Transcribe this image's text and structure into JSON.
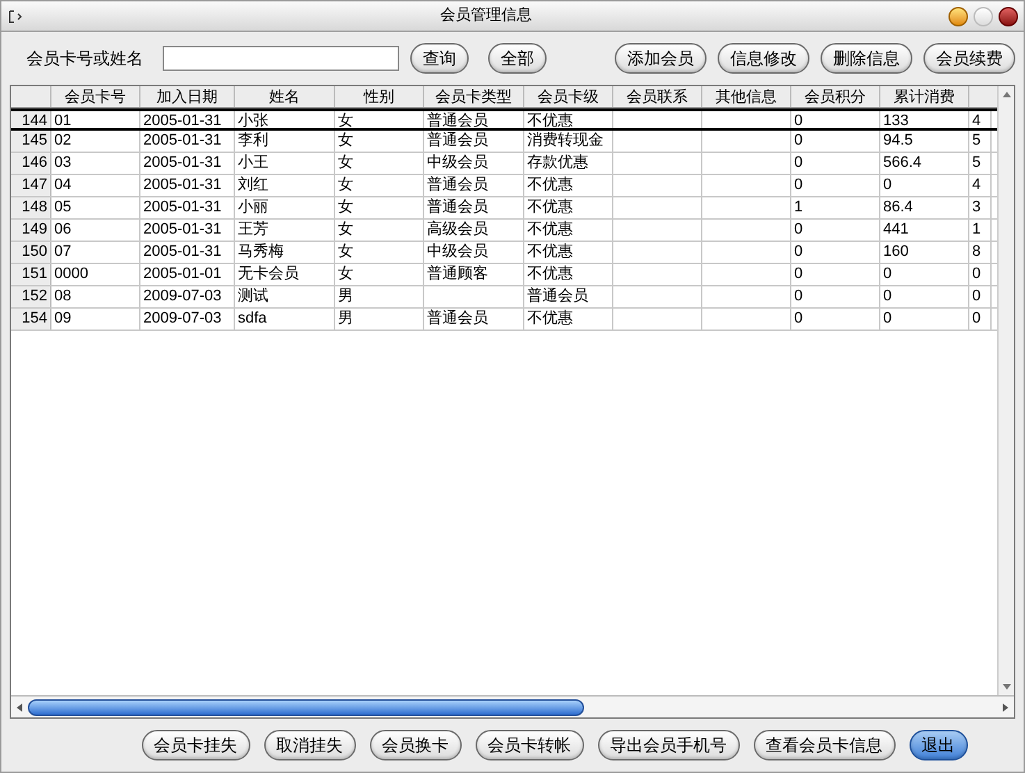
{
  "window": {
    "title": "会员管理信息"
  },
  "search": {
    "label": "会员卡号或姓名"
  },
  "top_buttons": [
    "查询",
    "全部",
    "添加会员",
    "信息修改",
    "删除信息",
    "会员续费"
  ],
  "table": {
    "columns": [
      "会员卡号",
      "加入日期",
      "姓名",
      "性别",
      "会员卡类型",
      "会员卡级",
      "会员联系",
      "其他信息",
      "会员积分",
      "累计消费"
    ],
    "rows": [
      {
        "row_number": "144",
        "selected": true,
        "cells": [
          "01",
          "2005-01-31",
          "小张",
          "女",
          "普通会员",
          "不优惠",
          "",
          "",
          "0",
          "133",
          "4"
        ]
      },
      {
        "row_number": "145",
        "selected": false,
        "cells": [
          "02",
          "2005-01-31",
          "李利",
          "女",
          "普通会员",
          "消费转现金",
          "",
          "",
          "0",
          "94.5",
          "5"
        ]
      },
      {
        "row_number": "146",
        "selected": false,
        "cells": [
          "03",
          "2005-01-31",
          "小王",
          "女",
          "中级会员",
          "存款优惠",
          "",
          "",
          "0",
          "566.4",
          "5"
        ]
      },
      {
        "row_number": "147",
        "selected": false,
        "cells": [
          "04",
          "2005-01-31",
          "刘红",
          "女",
          "普通会员",
          "不优惠",
          "",
          "",
          "0",
          "0",
          "4"
        ]
      },
      {
        "row_number": "148",
        "selected": false,
        "cells": [
          "05",
          "2005-01-31",
          "小丽",
          "女",
          "普通会员",
          "不优惠",
          "",
          "",
          "1",
          "86.4",
          "3"
        ]
      },
      {
        "row_number": "149",
        "selected": false,
        "cells": [
          "06",
          "2005-01-31",
          "王芳",
          "女",
          "高级会员",
          "不优惠",
          "",
          "",
          "0",
          "441",
          "1"
        ]
      },
      {
        "row_number": "150",
        "selected": false,
        "cells": [
          "07",
          "2005-01-31",
          "马秀梅",
          "女",
          "中级会员",
          "不优惠",
          "",
          "",
          "0",
          "160",
          "8"
        ]
      },
      {
        "row_number": "151",
        "selected": false,
        "cells": [
          "0000",
          "2005-01-01",
          "无卡会员",
          "女",
          "普通顾客",
          "不优惠",
          "",
          "",
          "0",
          "0",
          "0"
        ]
      },
      {
        "row_number": "152",
        "selected": false,
        "cells": [
          "08",
          "2009-07-03",
          "测试",
          "男",
          "",
          "普通会员",
          "",
          "",
          "0",
          "0",
          "0"
        ]
      },
      {
        "row_number": "154",
        "selected": false,
        "cells": [
          "09",
          "2009-07-03",
          "sdfa",
          "男",
          "普通会员",
          "不优惠",
          "",
          "",
          "0",
          "0",
          "0"
        ]
      }
    ]
  },
  "bottom_buttons": [
    {
      "label": "会员卡挂失",
      "kind": "normal"
    },
    {
      "label": "取消挂失",
      "kind": "normal"
    },
    {
      "label": "会员换卡",
      "kind": "normal"
    },
    {
      "label": "会员卡转帐",
      "kind": "normal"
    },
    {
      "label": "导出会员手机号",
      "kind": "normal"
    },
    {
      "label": "查看会员卡信息",
      "kind": "normal"
    },
    {
      "label": "退出",
      "kind": "default"
    }
  ]
}
